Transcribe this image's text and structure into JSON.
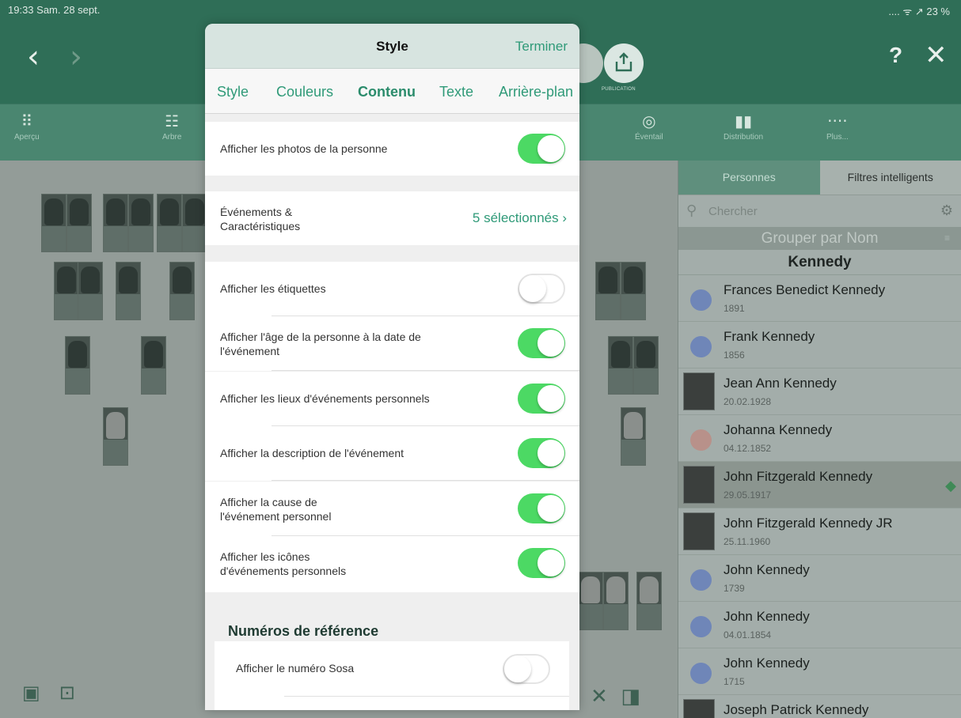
{
  "status_bar": {
    "time_date": "19:33  Sam. 28 sept.",
    "indicators": "....  ᯤ ↗ 23 %"
  },
  "topbar": {
    "back_glyph": "‹",
    "forward_glyph": "›",
    "publish_label": "PUBLICATION",
    "help": "?",
    "close": "✕"
  },
  "toolbar": {
    "items": [
      {
        "label": "Aperçu",
        "icon": "grid-icon"
      },
      {
        "label": "Arbre",
        "icon": "tree-icon"
      },
      {
        "label": "Éventail",
        "icon": "fan-icon"
      },
      {
        "label": "Distribution",
        "icon": "distribution-icon"
      },
      {
        "label": "Plus...",
        "icon": "more-icon"
      }
    ]
  },
  "right_panel": {
    "tabs": [
      "Personnes",
      "Filtres intelligents"
    ],
    "search_placeholder": "Chercher",
    "group_by": "Grouper par Nom",
    "family": "Kennedy",
    "persons": [
      {
        "name": "Frances Benedict Kennedy",
        "date": "1891",
        "avatar": "circle",
        "color": "#6f86b8"
      },
      {
        "name": "Frank Kennedy",
        "date": "1856",
        "avatar": "circle",
        "color": "#6f86b8"
      },
      {
        "name": "Jean Ann Kennedy",
        "date": "20.02.1928",
        "avatar": "photo"
      },
      {
        "name": "Johanna Kennedy",
        "date": "04.12.1852",
        "avatar": "circle",
        "color": "#b8918a"
      },
      {
        "name": "John Fitzgerald Kennedy",
        "date": "29.05.1917",
        "avatar": "photo",
        "selected": true
      },
      {
        "name": "John Fitzgerald Kennedy JR",
        "date": "25.11.1960",
        "avatar": "photo"
      },
      {
        "name": "John Kennedy",
        "date": "1739",
        "avatar": "circle",
        "color": "#6f86b8"
      },
      {
        "name": "John Kennedy",
        "date": "04.01.1854",
        "avatar": "circle",
        "color": "#6f86b8"
      },
      {
        "name": "John Kennedy",
        "date": "1715",
        "avatar": "circle",
        "color": "#6f86b8"
      },
      {
        "name": "Joseph Patrick Kennedy",
        "date": "",
        "avatar": "photo"
      }
    ]
  },
  "modal": {
    "title": "Style",
    "done": "Terminer",
    "tabs": [
      "Style",
      "Couleurs",
      "Contenu",
      "Texte",
      "Arrière-plan"
    ],
    "active_tab": "Contenu",
    "photos_row": {
      "label": "Afficher les photos de la personne",
      "on": true
    },
    "events_row": {
      "label": "Événements &\nCaractéristiques",
      "value": "5 sélectionnés ›"
    },
    "options": [
      {
        "label": "Afficher les étiquettes",
        "on": false
      },
      {
        "label": "Afficher l'âge de la personne à la date de\nl'événement",
        "on": true
      },
      {
        "label": "Afficher les lieux d'événements personnels",
        "on": true
      },
      {
        "label": "Afficher la description de l'événement",
        "on": true
      },
      {
        "label": "Afficher la cause de\nl'événement personnel",
        "on": true
      },
      {
        "label": "Afficher les icônes\nd'événements personnels",
        "on": true
      }
    ],
    "ref_title": "Numéros de référence",
    "sosa_row": {
      "label": "Afficher le numéro Sosa",
      "on": false
    }
  },
  "colors": {
    "accent": "#2f9a78",
    "toggle_on": "#4cd964",
    "header_green": "#2f6e57"
  }
}
